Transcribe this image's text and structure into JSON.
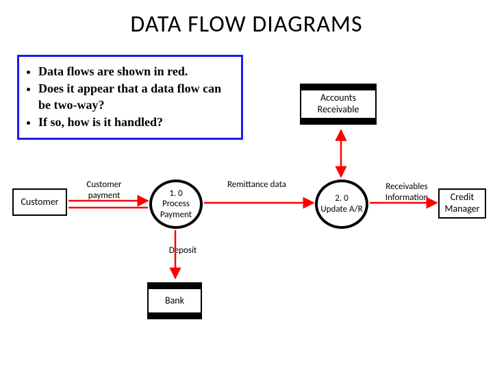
{
  "title": "DATA FLOW DIAGRAMS",
  "bullets": {
    "b1": "Data flows are shown in red.",
    "b2": "Does it appear that a data flow can be two-way?",
    "b3": "If so, how is it handled?"
  },
  "entities": {
    "customer": "Customer",
    "accounts_receivable": "Accounts Receivable",
    "bank": "Bank",
    "credit_manager": "Credit Manager"
  },
  "processes": {
    "p1_num": "1. 0",
    "p1_name": "Process Payment",
    "p2_num": "2. 0",
    "p2_name": "Update A/R"
  },
  "flows": {
    "customer_payment": "Customer payment",
    "remittance_data": "Remittance data",
    "deposit": "Deposit",
    "receivables_info": "Receivables Information"
  },
  "colors": {
    "flow_red": "#ff0000",
    "box_blue": "#1a1af0"
  }
}
